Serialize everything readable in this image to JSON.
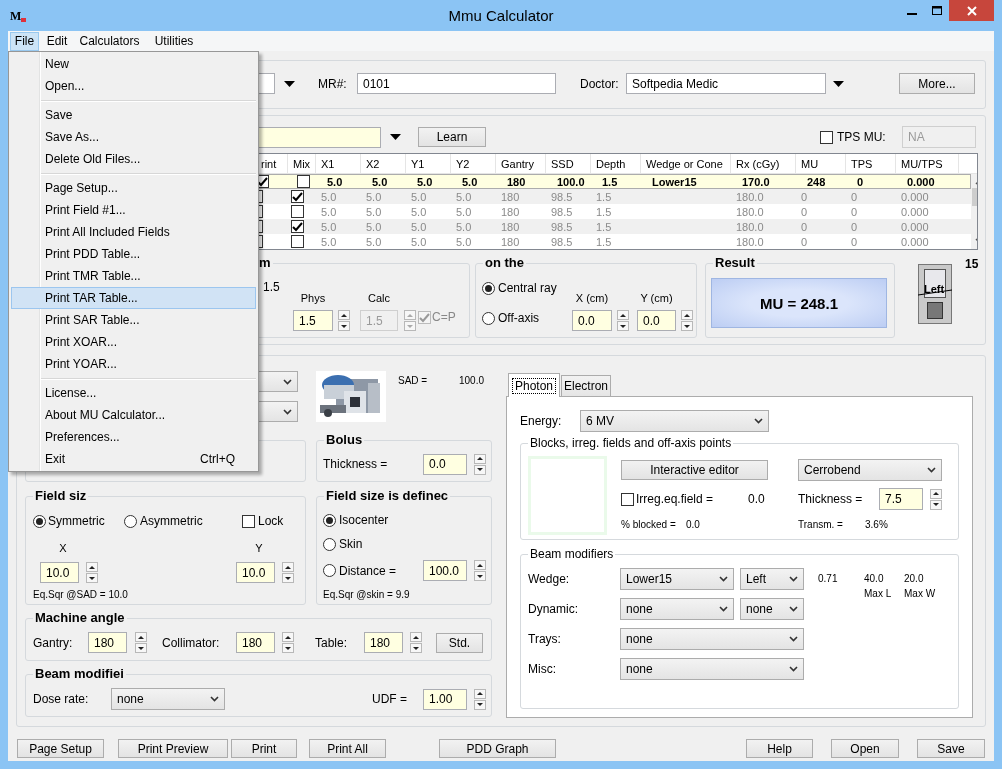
{
  "window": {
    "icon_text": "M",
    "title": "Mmu Calculator"
  },
  "menu_bar": [
    {
      "label": "File",
      "selected": true
    },
    {
      "label": "Edit",
      "selected": false
    },
    {
      "label": "Calculators",
      "selected": false
    },
    {
      "label": "Utilities",
      "selected": false
    }
  ],
  "file_menu": {
    "sections": [
      [
        {
          "label": "New",
          "selected": false
        },
        {
          "label": "Open...",
          "selected": false
        }
      ],
      [
        {
          "label": "Save",
          "selected": false
        },
        {
          "label": "Save As...",
          "selected": false
        },
        {
          "label": "Delete Old Files...",
          "selected": false
        }
      ],
      [
        {
          "label": "Page Setup...",
          "selected": false
        },
        {
          "label": "Print Field #1...",
          "selected": false
        },
        {
          "label": "Print All Included Fields",
          "selected": false
        },
        {
          "label": "Print PDD Table...",
          "selected": false
        },
        {
          "label": "Print TMR Table...",
          "selected": false
        },
        {
          "label": "Print TAR Table...",
          "selected": true
        },
        {
          "label": "Print SAR Table...",
          "selected": false
        },
        {
          "label": "Print XOAR...",
          "selected": false
        },
        {
          "label": "Print YOAR...",
          "selected": false
        }
      ],
      [
        {
          "label": "License...",
          "selected": false
        },
        {
          "label": "About MU Calculator...",
          "selected": false
        },
        {
          "label": "Preferences...",
          "selected": false
        },
        {
          "label": "Exit",
          "shortcut": "Ctrl+Q",
          "selected": false
        }
      ]
    ]
  },
  "patient": {
    "mr_label": "MR#:",
    "mr_value": "0101",
    "doctor_label": "Doctor:",
    "doctor_value": "Softpedia Medic",
    "more_button": "More..."
  },
  "field_bar": {
    "learn_button": "Learn",
    "tps_mu": {
      "label": "TPS MU:",
      "checked": false
    },
    "tps_value": "NA"
  },
  "table": {
    "columns": [
      "rint",
      "Mix",
      "X1",
      "X2",
      "Y1",
      "Y2",
      "Gantry",
      "SSD",
      "Depth",
      "Wedge or Cone",
      "Rx (cGy)",
      "MU",
      "TPS",
      "MU/TPS"
    ],
    "rows": [
      {
        "selected": true,
        "cells": [
          {
            "kind": "checkbox",
            "checked": true
          },
          {
            "kind": "checkbox",
            "checked": false
          },
          "5.0",
          "5.0",
          "5.0",
          "5.0",
          "180",
          "100.0",
          "1.5",
          "Lower15",
          "170.0",
          "248",
          "0",
          "0.000"
        ]
      },
      {
        "selected": false,
        "cells": [
          {
            "kind": "checkbox"
          },
          {
            "kind": "checkbox",
            "checked": true
          },
          "5.0",
          "5.0",
          "5.0",
          "5.0",
          "180",
          "98.5",
          "1.5",
          "",
          "180.0",
          "0",
          "0",
          "0.000"
        ]
      },
      {
        "selected": false,
        "cells": [
          {
            "kind": "checkbox"
          },
          {
            "kind": "checkbox",
            "checked": false
          },
          "5.0",
          "5.0",
          "5.0",
          "5.0",
          "180",
          "98.5",
          "1.5",
          "",
          "180.0",
          "0",
          "0",
          "0.000"
        ]
      },
      {
        "selected": false,
        "cells": [
          {
            "kind": "checkbox"
          },
          {
            "kind": "checkbox",
            "checked": true
          },
          "5.0",
          "5.0",
          "5.0",
          "5.0",
          "180",
          "98.5",
          "1.5",
          "",
          "180.0",
          "0",
          "0",
          "0.000"
        ]
      },
      {
        "selected": false,
        "cells": [
          {
            "kind": "checkbox"
          },
          {
            "kind": "checkbox",
            "checked": false
          },
          "5.0",
          "5.0",
          "5.0",
          "5.0",
          "180",
          "98.5",
          "1.5",
          "",
          "180.0",
          "0",
          "0",
          "0.000"
        ]
      }
    ]
  },
  "depth": {
    "title": "m",
    "value": "1.5",
    "phys_label": "Phys",
    "phys_value": "1.5",
    "calc_label": "Calc",
    "calc_value": "1.5",
    "cp": {
      "label": "C=P",
      "checked": true
    }
  },
  "point": {
    "title": "on the",
    "options": [
      {
        "label": "Central ray",
        "selected": true
      },
      {
        "label": "Off-axis",
        "selected": false
      }
    ],
    "x_label": "X (cm)",
    "x_value": "0.0",
    "y_label": "Y (cm)",
    "y_value": "0.0"
  },
  "result": {
    "title": "Result",
    "value": "MU = 248.1"
  },
  "wedge_view": {
    "label": "Left",
    "angle": "15"
  },
  "machine": {
    "sad_label": "SAD =",
    "sad_value": "100.0"
  },
  "bolus": {
    "title": "Bolus",
    "label": "Thickness =",
    "value": "0.0"
  },
  "field_size": {
    "title": "Field siz",
    "options": [
      {
        "label": "Symmetric",
        "selected": true
      },
      {
        "label": "Asymmetric",
        "selected": false
      }
    ],
    "lock": {
      "label": "Lock",
      "checked": false
    },
    "x_label": "X",
    "x_value": "10.0",
    "y_label": "Y",
    "y_value": "10.0",
    "eq_sqr": "Eq.Sqr @SAD = 10.0"
  },
  "field_defined": {
    "title": "Field size is definec",
    "options": [
      {
        "label": "Isocenter",
        "selected": true
      },
      {
        "label": "Skin",
        "selected": false
      },
      {
        "label": "Distance =",
        "selected": false
      }
    ],
    "distance_value": "100.0",
    "eq_sqr": "Eq.Sqr @skin = 9.9"
  },
  "machine_angle": {
    "title": "Machine angle",
    "fields": [
      {
        "label": "Gantry:",
        "value": "180"
      },
      {
        "label": "Collimator:",
        "value": "180"
      },
      {
        "label": "Table:",
        "value": "180"
      }
    ],
    "std_button": "Std."
  },
  "beam_modifier": {
    "title": "Beam modifiei",
    "dose_rate_label": "Dose rate:",
    "dose_rate": "none",
    "udf_label": "UDF =",
    "udf_value": "1.00"
  },
  "tabs": [
    {
      "label": "Photon",
      "selected": true
    },
    {
      "label": "Electron",
      "selected": false
    }
  ],
  "photon": {
    "energy_label": "Energy:",
    "energy": "6 MV",
    "blocks": {
      "title": "Blocks, irreg. fields and off-axis points",
      "editor_button": "Interactive editor",
      "material": "Cerrobend",
      "irreg": {
        "label": "Irreg.eq.field =",
        "checked": false
      },
      "irreg_value": "0.0",
      "thickness_label": "Thickness =",
      "thickness_value": "7.5",
      "blocked_label": "% blocked =",
      "blocked_value": "0.0",
      "transm_label": "Transm. =",
      "transm_value": "3.6%"
    },
    "modifiers": {
      "title": "Beam modifiers",
      "rows": [
        {
          "label": "Wedge:",
          "selects": [
            "Lower15",
            "Left"
          ]
        },
        {
          "label": "Dynamic:",
          "selects": [
            "none",
            "none"
          ]
        },
        {
          "label": "Trays:",
          "selects": [
            "none"
          ]
        },
        {
          "label": "Misc:",
          "selects": [
            "none"
          ]
        }
      ],
      "wedge_factor": "0.71",
      "max_l_value": "40.0",
      "max_l_label": "Max L",
      "max_w_value": "20.0",
      "max_w_label": "Max W"
    }
  },
  "buttons_left": [
    "Page Setup",
    "Print Preview",
    "Print",
    "Print All"
  ],
  "graph_button": "PDD Graph",
  "buttons_right": [
    "Help",
    "Open",
    "Save"
  ]
}
